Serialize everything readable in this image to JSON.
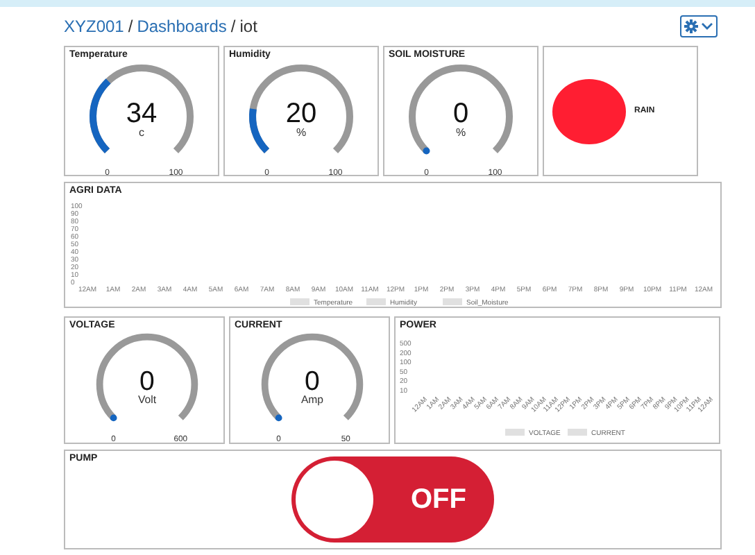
{
  "breadcrumb": [
    {
      "label": "XYZ001",
      "kind": "link"
    },
    {
      "label": "Dashboards",
      "kind": "link"
    },
    {
      "label": "iot",
      "kind": "current"
    }
  ],
  "separator": "/",
  "gauges_top": [
    {
      "title": "Temperature",
      "value": "34",
      "unit": "c",
      "min": "0",
      "max": "100"
    },
    {
      "title": "Humidity",
      "value": "20",
      "unit": "%",
      "min": "0",
      "max": "100"
    },
    {
      "title": "SOIL MOISTURE",
      "value": "0",
      "unit": "%",
      "min": "0",
      "max": "100"
    }
  ],
  "rain": {
    "label": "RAIN",
    "on": true
  },
  "agri": {
    "title": "AGRI DATA",
    "chart_data": {
      "type": "line",
      "categories": [
        "12AM",
        "1AM",
        "2AM",
        "3AM",
        "4AM",
        "5AM",
        "6AM",
        "7AM",
        "8AM",
        "9AM",
        "10AM",
        "11AM",
        "12PM",
        "1PM",
        "2PM",
        "3PM",
        "4PM",
        "5PM",
        "6PM",
        "7PM",
        "8PM",
        "9PM",
        "10PM",
        "11PM",
        "12AM"
      ],
      "ylim": [
        0,
        100
      ],
      "yticks": [
        0,
        10,
        20,
        30,
        40,
        50,
        60,
        70,
        80,
        90,
        100
      ],
      "series": [
        {
          "name": "Temperature",
          "color": "#e0e0e0",
          "values": [
            null,
            null,
            null,
            null,
            null,
            null,
            null,
            null,
            null,
            null,
            null,
            null,
            null,
            null,
            null,
            null,
            null,
            null,
            null,
            null,
            null,
            null,
            null,
            null,
            null
          ]
        },
        {
          "name": "Humidity",
          "color": "#e0e0e0",
          "values": [
            null,
            null,
            null,
            null,
            null,
            null,
            null,
            null,
            null,
            null,
            null,
            null,
            null,
            null,
            null,
            null,
            null,
            null,
            null,
            null,
            null,
            null,
            null,
            null,
            null
          ]
        },
        {
          "name": "Soil_Moisture",
          "color": "#e0e0e0",
          "values": [
            null,
            null,
            null,
            null,
            null,
            null,
            null,
            null,
            null,
            null,
            null,
            null,
            null,
            null,
            null,
            null,
            null,
            null,
            null,
            null,
            null,
            null,
            null,
            null,
            null
          ]
        }
      ]
    }
  },
  "gauges_bottom": [
    {
      "title": "VOLTAGE",
      "value": "0",
      "unit": "Volt",
      "min": "0",
      "max": "600"
    },
    {
      "title": "CURRENT",
      "value": "0",
      "unit": "Amp",
      "min": "0",
      "max": "50"
    }
  ],
  "power": {
    "title": "POWER",
    "y_axis_labels": [
      "500",
      "200",
      "100",
      "50",
      "20",
      "10"
    ],
    "x_axis_labels": [
      "12AM",
      "1AM",
      "2AM",
      "3AM",
      "4AM",
      "5AM",
      "6AM",
      "7AM",
      "8AM",
      "9AM",
      "10AM",
      "11AM",
      "12PM",
      "1PM",
      "2PM",
      "3PM",
      "4PM",
      "5PM",
      "6PM",
      "7PM",
      "8PM",
      "9PM",
      "10PM",
      "11PM",
      "12AM"
    ],
    "legend": [
      {
        "name": "VOLTAGE"
      },
      {
        "name": "CURRENT"
      }
    ]
  },
  "pump": {
    "title": "PUMP",
    "label": "OFF",
    "on": false
  }
}
